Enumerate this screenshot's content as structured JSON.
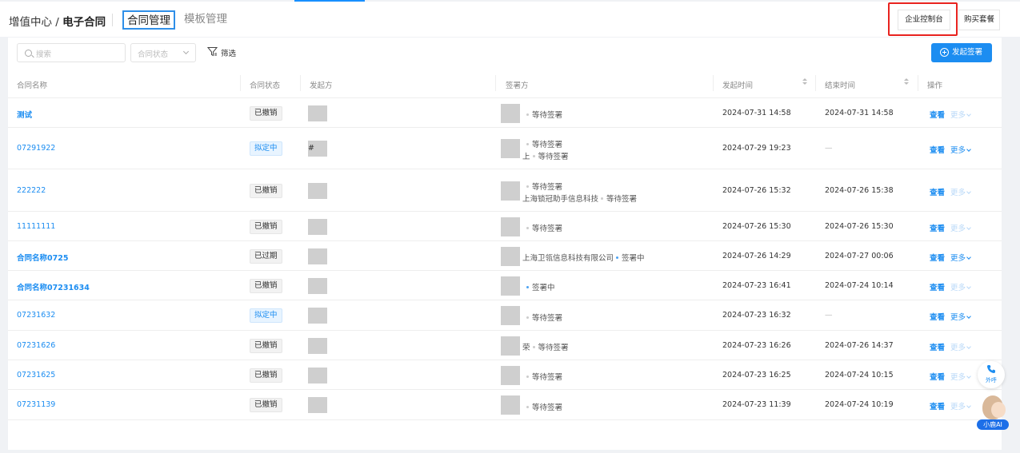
{
  "header": {
    "breadcrumb_prefix": "增值中心 / ",
    "breadcrumb_current": "电子合同",
    "tabs": [
      {
        "label": "合同管理",
        "active": true
      },
      {
        "label": "模板管理",
        "active": false
      }
    ],
    "console_button": "企业控制台",
    "buy_button": "购买套餐"
  },
  "toolbar": {
    "search_placeholder": "搜索",
    "status_select": "合同状态",
    "filter_label": "筛选",
    "primary_button": "发起签署"
  },
  "table": {
    "columns": [
      "合同名称",
      "合同状态",
      "发起方",
      "签署方",
      "发起时间",
      "结束时间",
      "操作"
    ],
    "view_label": "查看",
    "more_label": "更多",
    "rows": [
      {
        "name": "测试",
        "status": "已撤销",
        "initiator": "",
        "signers": [
          {
            "text": "",
            "state": "等待签署"
          }
        ],
        "start": "2024-07-31 14:58",
        "end": "2024-07-31 14:58"
      },
      {
        "name": "07291922",
        "status": "拟定中",
        "initiator": "#",
        "signers": [
          {
            "text": "",
            "state": "等待签署"
          },
          {
            "text": "上",
            "state": "等待签署"
          }
        ],
        "start": "2024-07-29 19:23",
        "end": "—"
      },
      {
        "name": "222222",
        "status": "已撤销",
        "initiator": "",
        "signers": [
          {
            "text": "",
            "state": "等待签署"
          },
          {
            "text": "上海锁冠助手信息科技",
            "state": "等待签署"
          }
        ],
        "start": "2024-07-26 15:32",
        "end": "2024-07-26 15:38"
      },
      {
        "name": "11111111",
        "status": "已撤销",
        "initiator": "",
        "signers": [
          {
            "text": "",
            "state": "等待签署"
          }
        ],
        "start": "2024-07-26 15:30",
        "end": "2024-07-26 15:30"
      },
      {
        "name": "合同名称0725",
        "status": "已过期",
        "initiator": "",
        "signers": [
          {
            "text": "上海卫瓴信息科技有限公司",
            "state": "签署中"
          }
        ],
        "start": "2024-07-26 14:29",
        "end": "2024-07-27 00:06"
      },
      {
        "name": "合同名称07231634",
        "status": "已撤销",
        "initiator": "",
        "signers": [
          {
            "text": "",
            "state": "签署中"
          }
        ],
        "start": "2024-07-23 16:41",
        "end": "2024-07-24 10:14"
      },
      {
        "name": "07231632",
        "status": "拟定中",
        "initiator": "",
        "signers": [
          {
            "text": "",
            "state": "等待签署"
          }
        ],
        "start": "2024-07-23 16:32",
        "end": "—"
      },
      {
        "name": "07231626",
        "status": "已撤销",
        "initiator": "",
        "signers": [
          {
            "text": "荣",
            "state": "等待签署"
          }
        ],
        "start": "2024-07-23 16:26",
        "end": "2024-07-26 14:37"
      },
      {
        "name": "07231625",
        "status": "已撤销",
        "initiator": "",
        "signers": [
          {
            "text": "",
            "state": "等待签署"
          }
        ],
        "start": "2024-07-23 16:25",
        "end": "2024-07-24 10:15"
      },
      {
        "name": "07231139",
        "status": "已撤销",
        "initiator": "",
        "signers": [
          {
            "text": "",
            "state": "等待签署"
          }
        ],
        "start": "2024-07-23 11:39",
        "end": "2024-07-24 10:19"
      }
    ]
  },
  "floating": {
    "call_label": "外呼",
    "ai_label": "小鹿AI"
  }
}
